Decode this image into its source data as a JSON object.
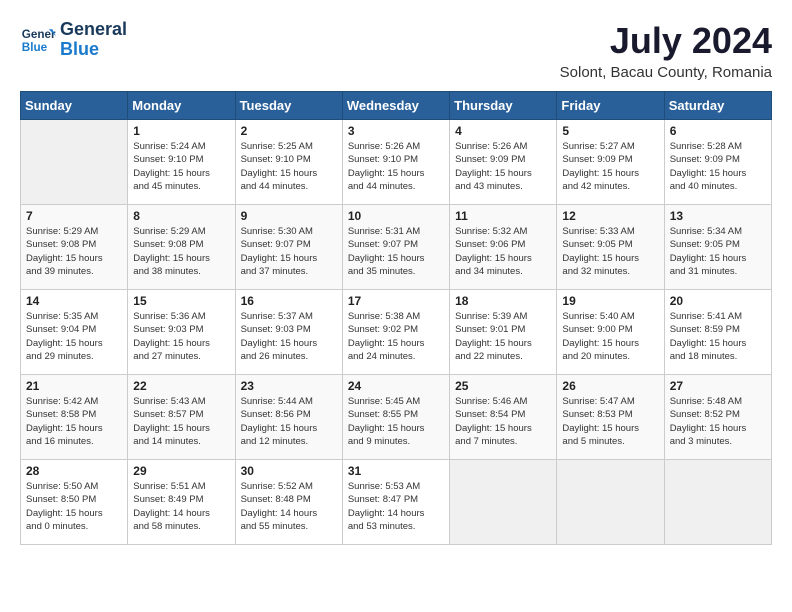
{
  "header": {
    "logo_line1": "General",
    "logo_line2": "Blue",
    "month_year": "July 2024",
    "location": "Solont, Bacau County, Romania"
  },
  "weekdays": [
    "Sunday",
    "Monday",
    "Tuesday",
    "Wednesday",
    "Thursday",
    "Friday",
    "Saturday"
  ],
  "weeks": [
    [
      {
        "day": "",
        "info": ""
      },
      {
        "day": "1",
        "info": "Sunrise: 5:24 AM\nSunset: 9:10 PM\nDaylight: 15 hours\nand 45 minutes."
      },
      {
        "day": "2",
        "info": "Sunrise: 5:25 AM\nSunset: 9:10 PM\nDaylight: 15 hours\nand 44 minutes."
      },
      {
        "day": "3",
        "info": "Sunrise: 5:26 AM\nSunset: 9:10 PM\nDaylight: 15 hours\nand 44 minutes."
      },
      {
        "day": "4",
        "info": "Sunrise: 5:26 AM\nSunset: 9:09 PM\nDaylight: 15 hours\nand 43 minutes."
      },
      {
        "day": "5",
        "info": "Sunrise: 5:27 AM\nSunset: 9:09 PM\nDaylight: 15 hours\nand 42 minutes."
      },
      {
        "day": "6",
        "info": "Sunrise: 5:28 AM\nSunset: 9:09 PM\nDaylight: 15 hours\nand 40 minutes."
      }
    ],
    [
      {
        "day": "7",
        "info": "Sunrise: 5:29 AM\nSunset: 9:08 PM\nDaylight: 15 hours\nand 39 minutes."
      },
      {
        "day": "8",
        "info": "Sunrise: 5:29 AM\nSunset: 9:08 PM\nDaylight: 15 hours\nand 38 minutes."
      },
      {
        "day": "9",
        "info": "Sunrise: 5:30 AM\nSunset: 9:07 PM\nDaylight: 15 hours\nand 37 minutes."
      },
      {
        "day": "10",
        "info": "Sunrise: 5:31 AM\nSunset: 9:07 PM\nDaylight: 15 hours\nand 35 minutes."
      },
      {
        "day": "11",
        "info": "Sunrise: 5:32 AM\nSunset: 9:06 PM\nDaylight: 15 hours\nand 34 minutes."
      },
      {
        "day": "12",
        "info": "Sunrise: 5:33 AM\nSunset: 9:05 PM\nDaylight: 15 hours\nand 32 minutes."
      },
      {
        "day": "13",
        "info": "Sunrise: 5:34 AM\nSunset: 9:05 PM\nDaylight: 15 hours\nand 31 minutes."
      }
    ],
    [
      {
        "day": "14",
        "info": "Sunrise: 5:35 AM\nSunset: 9:04 PM\nDaylight: 15 hours\nand 29 minutes."
      },
      {
        "day": "15",
        "info": "Sunrise: 5:36 AM\nSunset: 9:03 PM\nDaylight: 15 hours\nand 27 minutes."
      },
      {
        "day": "16",
        "info": "Sunrise: 5:37 AM\nSunset: 9:03 PM\nDaylight: 15 hours\nand 26 minutes."
      },
      {
        "day": "17",
        "info": "Sunrise: 5:38 AM\nSunset: 9:02 PM\nDaylight: 15 hours\nand 24 minutes."
      },
      {
        "day": "18",
        "info": "Sunrise: 5:39 AM\nSunset: 9:01 PM\nDaylight: 15 hours\nand 22 minutes."
      },
      {
        "day": "19",
        "info": "Sunrise: 5:40 AM\nSunset: 9:00 PM\nDaylight: 15 hours\nand 20 minutes."
      },
      {
        "day": "20",
        "info": "Sunrise: 5:41 AM\nSunset: 8:59 PM\nDaylight: 15 hours\nand 18 minutes."
      }
    ],
    [
      {
        "day": "21",
        "info": "Sunrise: 5:42 AM\nSunset: 8:58 PM\nDaylight: 15 hours\nand 16 minutes."
      },
      {
        "day": "22",
        "info": "Sunrise: 5:43 AM\nSunset: 8:57 PM\nDaylight: 15 hours\nand 14 minutes."
      },
      {
        "day": "23",
        "info": "Sunrise: 5:44 AM\nSunset: 8:56 PM\nDaylight: 15 hours\nand 12 minutes."
      },
      {
        "day": "24",
        "info": "Sunrise: 5:45 AM\nSunset: 8:55 PM\nDaylight: 15 hours\nand 9 minutes."
      },
      {
        "day": "25",
        "info": "Sunrise: 5:46 AM\nSunset: 8:54 PM\nDaylight: 15 hours\nand 7 minutes."
      },
      {
        "day": "26",
        "info": "Sunrise: 5:47 AM\nSunset: 8:53 PM\nDaylight: 15 hours\nand 5 minutes."
      },
      {
        "day": "27",
        "info": "Sunrise: 5:48 AM\nSunset: 8:52 PM\nDaylight: 15 hours\nand 3 minutes."
      }
    ],
    [
      {
        "day": "28",
        "info": "Sunrise: 5:50 AM\nSunset: 8:50 PM\nDaylight: 15 hours\nand 0 minutes."
      },
      {
        "day": "29",
        "info": "Sunrise: 5:51 AM\nSunset: 8:49 PM\nDaylight: 14 hours\nand 58 minutes."
      },
      {
        "day": "30",
        "info": "Sunrise: 5:52 AM\nSunset: 8:48 PM\nDaylight: 14 hours\nand 55 minutes."
      },
      {
        "day": "31",
        "info": "Sunrise: 5:53 AM\nSunset: 8:47 PM\nDaylight: 14 hours\nand 53 minutes."
      },
      {
        "day": "",
        "info": ""
      },
      {
        "day": "",
        "info": ""
      },
      {
        "day": "",
        "info": ""
      }
    ]
  ]
}
